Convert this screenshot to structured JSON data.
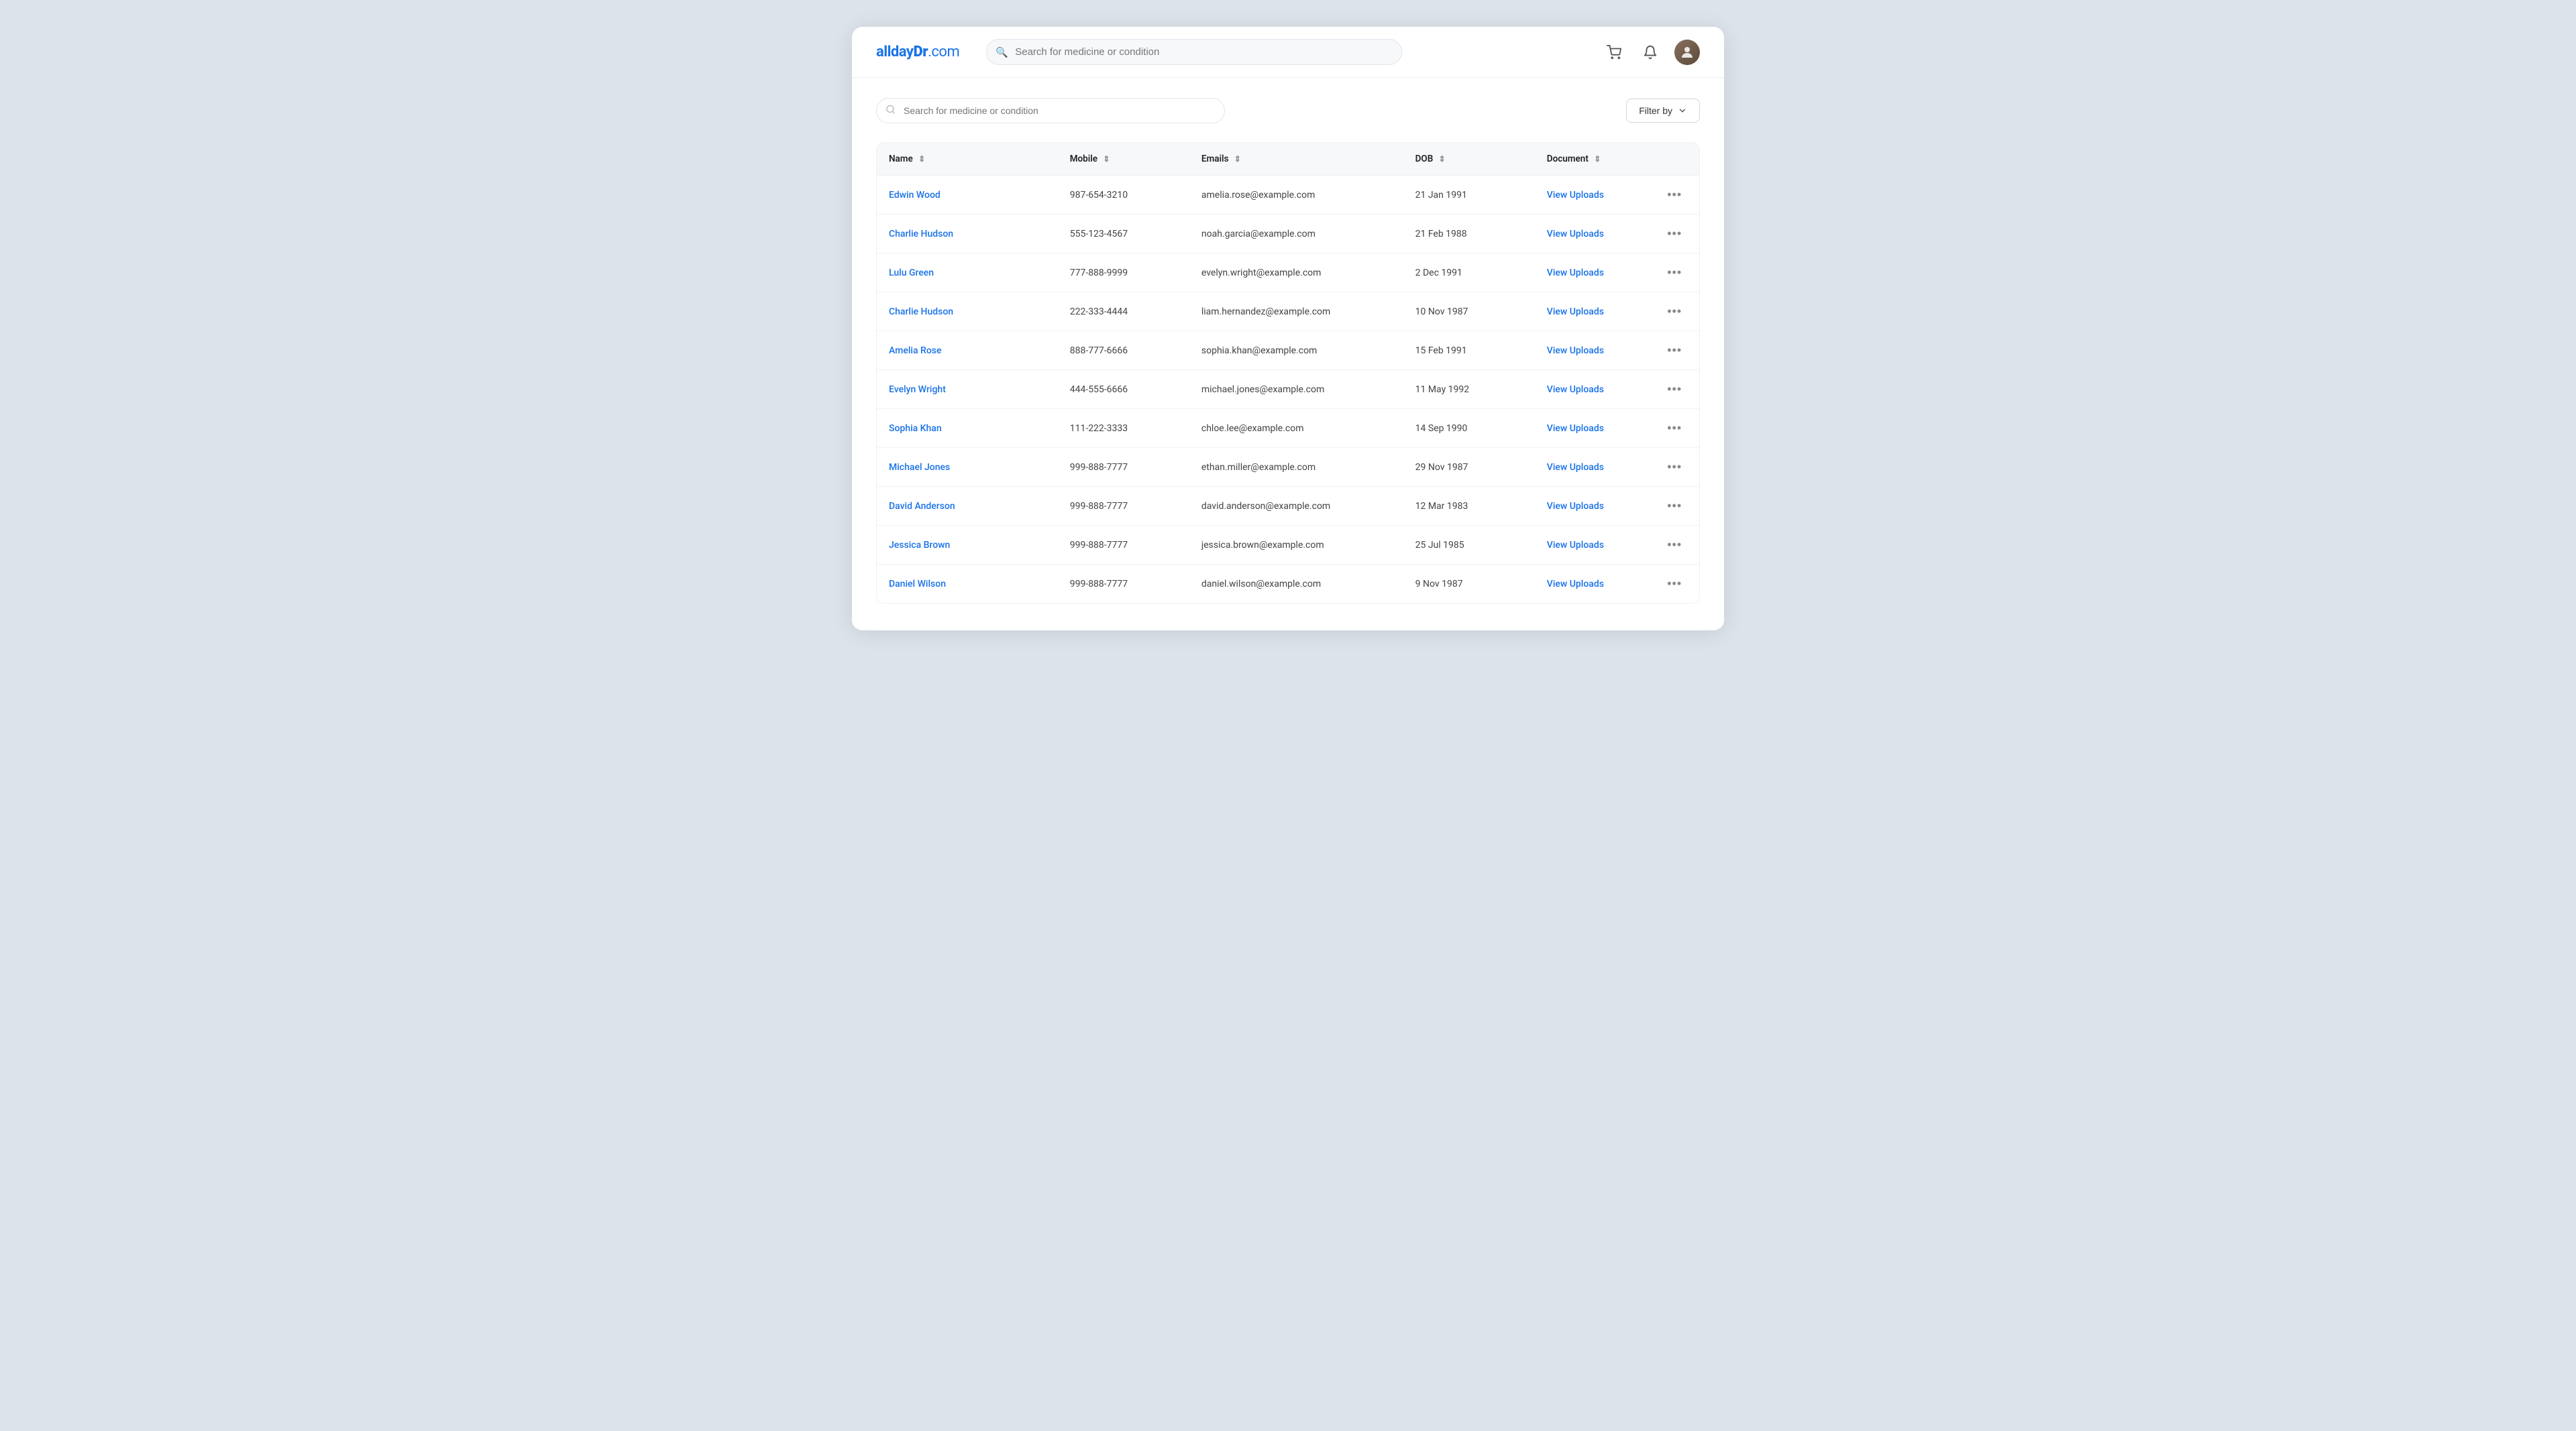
{
  "app": {
    "logo_allday": "allday",
    "logo_dr": "Dr",
    "logo_com": ".com"
  },
  "topnav": {
    "search_placeholder": "Search for medicine or condition",
    "cart_icon": "🛒",
    "bell_icon": "🔔",
    "avatar_initial": "👤"
  },
  "controls": {
    "search_placeholder": "Search for medicine or condition",
    "filter_label": "Filter by"
  },
  "table": {
    "columns": [
      {
        "key": "name",
        "label": "Name",
        "sort": true
      },
      {
        "key": "mobile",
        "label": "Mobile",
        "sort": true
      },
      {
        "key": "email",
        "label": "Emails",
        "sort": true
      },
      {
        "key": "dob",
        "label": "DOB",
        "sort": true
      },
      {
        "key": "document",
        "label": "Document",
        "sort": true
      }
    ],
    "rows": [
      {
        "id": 1,
        "name": "Edwin Wood",
        "mobile": "987-654-3210",
        "email": "amelia.rose@example.com",
        "dob": "21 Jan 1991",
        "doc_label": "View Uploads"
      },
      {
        "id": 2,
        "name": "Charlie Hudson",
        "mobile": "555-123-4567",
        "email": "noah.garcia@example.com",
        "dob": "21 Feb 1988",
        "doc_label": "View Uploads"
      },
      {
        "id": 3,
        "name": "Lulu Green",
        "mobile": "777-888-9999",
        "email": "evelyn.wright@example.com",
        "dob": "2 Dec 1991",
        "doc_label": "View Uploads"
      },
      {
        "id": 4,
        "name": "Charlie Hudson",
        "mobile": "222-333-4444",
        "email": "liam.hernandez@example.com",
        "dob": "10 Nov 1987",
        "doc_label": "View Uploads"
      },
      {
        "id": 5,
        "name": "Amelia Rose",
        "mobile": "888-777-6666",
        "email": "sophia.khan@example.com",
        "dob": "15 Feb 1991",
        "doc_label": "View Uploads"
      },
      {
        "id": 6,
        "name": "Evelyn Wright",
        "mobile": "444-555-6666",
        "email": "michael.jones@example.com",
        "dob": "11 May 1992",
        "doc_label": "View Uploads"
      },
      {
        "id": 7,
        "name": "Sophia Khan",
        "mobile": "111-222-3333",
        "email": "chloe.lee@example.com",
        "dob": "14 Sep 1990",
        "doc_label": "View Uploads"
      },
      {
        "id": 8,
        "name": "Michael Jones",
        "mobile": "999-888-7777",
        "email": "ethan.miller@example.com",
        "dob": "29 Nov 1987",
        "doc_label": "View Uploads"
      },
      {
        "id": 9,
        "name": "David Anderson",
        "mobile": "999-888-7777",
        "email": "david.anderson@example.com",
        "dob": "12 Mar 1983",
        "doc_label": "View Uploads"
      },
      {
        "id": 10,
        "name": "Jessica Brown",
        "mobile": "999-888-7777",
        "email": "jessica.brown@example.com",
        "dob": "25 Jul 1985",
        "doc_label": "View Uploads"
      },
      {
        "id": 11,
        "name": "Daniel Wilson",
        "mobile": "999-888-7777",
        "email": "daniel.wilson@example.com",
        "dob": "9 Nov 1987",
        "doc_label": "View Uploads"
      }
    ]
  }
}
